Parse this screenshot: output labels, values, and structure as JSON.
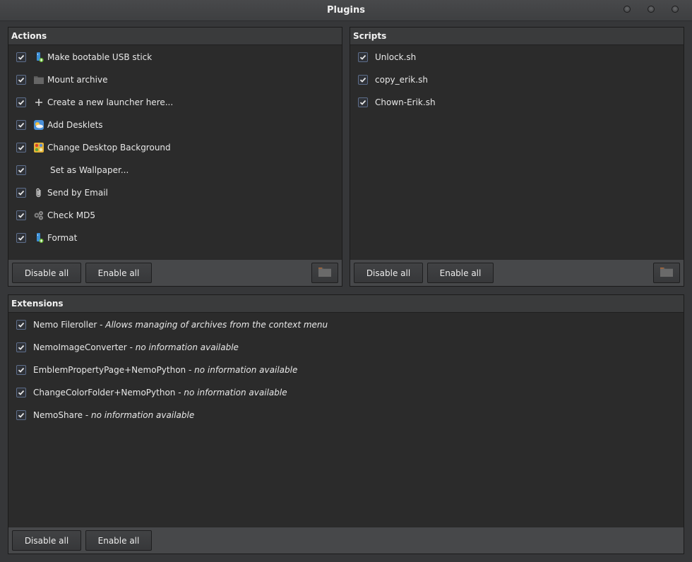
{
  "window": {
    "title": "Plugins",
    "controls": [
      "minimize",
      "maximize",
      "close"
    ]
  },
  "actions": {
    "header": "Actions",
    "items": [
      {
        "label": "Make bootable USB stick",
        "icon": "usb-drive-icon",
        "checked": true
      },
      {
        "label": "Mount archive",
        "icon": "folder-icon",
        "checked": true
      },
      {
        "label": "Create a new launcher here...",
        "icon": "plus-icon",
        "checked": true
      },
      {
        "label": "Add Desklets",
        "icon": "desklets-icon",
        "checked": true
      },
      {
        "label": "Change Desktop Background",
        "icon": "desktop-background-icon",
        "checked": true
      },
      {
        "label": "Set as Wallpaper...",
        "icon": "",
        "checked": true
      },
      {
        "label": "Send by Email",
        "icon": "paperclip-icon",
        "checked": true
      },
      {
        "label": "Check MD5",
        "icon": "gears-icon",
        "checked": true
      },
      {
        "label": "Format",
        "icon": "usb-drive-icon",
        "checked": true
      }
    ],
    "disable_all": "Disable all",
    "enable_all": "Enable all",
    "folder_button_icon": "folder-icon"
  },
  "scripts": {
    "header": "Scripts",
    "items": [
      {
        "label": "Unlock.sh",
        "checked": true
      },
      {
        "label": "copy_erik.sh",
        "checked": true
      },
      {
        "label": "Chown-Erik.sh",
        "checked": true
      }
    ],
    "disable_all": "Disable all",
    "enable_all": "Enable all",
    "folder_button_icon": "folder-icon"
  },
  "extensions": {
    "header": "Extensions",
    "items": [
      {
        "name": "Nemo Fileroller",
        "sep": " - ",
        "description": "Allows managing of archives from the context menu",
        "checked": true
      },
      {
        "name": "NemoImageConverter",
        "sep": " - ",
        "description": "no information available",
        "checked": true
      },
      {
        "name": "EmblemPropertyPage+NemoPython",
        "sep": " - ",
        "description": "no information available",
        "checked": true
      },
      {
        "name": "ChangeColorFolder+NemoPython",
        "sep": " - ",
        "description": "no information available",
        "checked": true
      },
      {
        "name": "NemoShare",
        "sep": " - ",
        "description": "no information available",
        "checked": true
      }
    ],
    "disable_all": "Disable all",
    "enable_all": "Enable all"
  },
  "colors": {
    "window_bg": "#363739",
    "list_bg": "#2b2b2b",
    "header_bg": "#3a3b3c",
    "button_bar_bg": "#47484a",
    "checkbox_border": "#5d6d8a"
  }
}
